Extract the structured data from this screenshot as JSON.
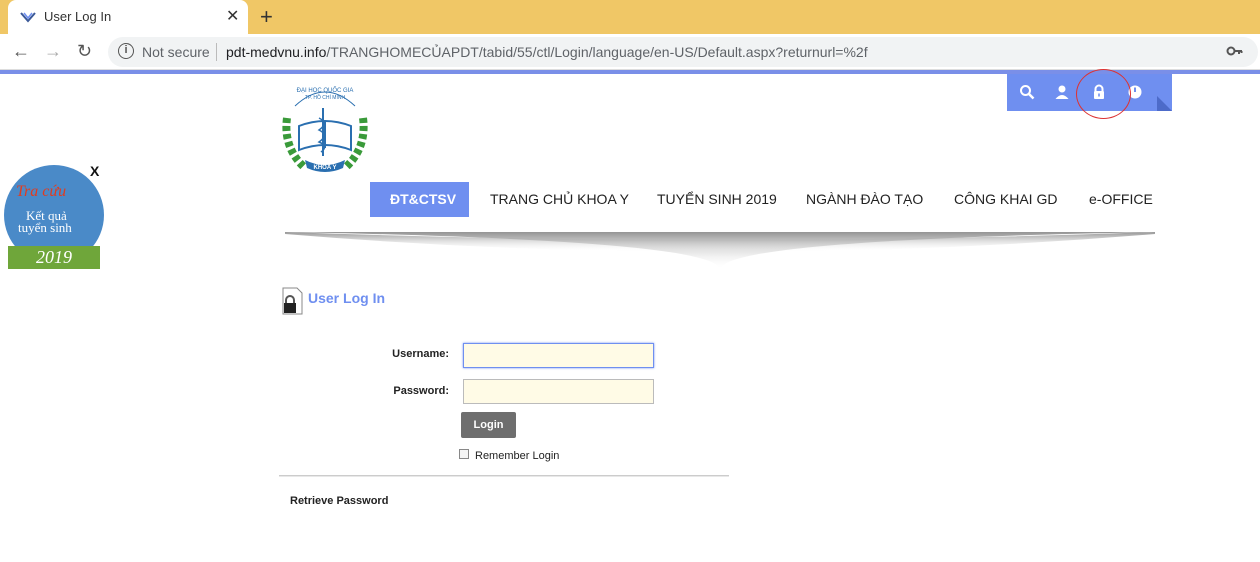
{
  "browser": {
    "tab_title": "User Log In",
    "tab_close": "✕",
    "new_tab": "+",
    "back": "←",
    "forward": "→",
    "reload": "↻",
    "security_label": "Not secure",
    "url_domain": "pdt-medvnu.info",
    "url_path": "/TRANGHOMECỦAPDT/tabid/55/ctl/Login/language/en-US/Default.aspx?returnurl=%2f"
  },
  "header": {
    "icons": [
      "search-icon",
      "user-icon",
      "lock-icon",
      "power-icon"
    ],
    "accent_color": "#6f8ff0"
  },
  "nav": {
    "items": [
      {
        "label": "ĐT&CTSV",
        "active": true
      },
      {
        "label": "TRANG CHỦ KHOA Y",
        "active": false
      },
      {
        "label": "TUYỂN SINH 2019",
        "active": false
      },
      {
        "label": "NGÀNH ĐÀO TẠO",
        "active": false
      },
      {
        "label": "CÔNG KHAI GD",
        "active": false
      },
      {
        "label": "e-OFFICE",
        "active": false
      }
    ]
  },
  "side_ad": {
    "close": "X",
    "line1": "Tra cứu",
    "line2": "Kết quả",
    "line3": "tuyển sinh",
    "year": "2019"
  },
  "login": {
    "title": "User Log In",
    "username_label": "Username:",
    "password_label": "Password:",
    "username_value": "",
    "password_value": "",
    "login_button": "Login",
    "remember_label": "Remember Login",
    "retrieve_link": "Retrieve Password"
  }
}
